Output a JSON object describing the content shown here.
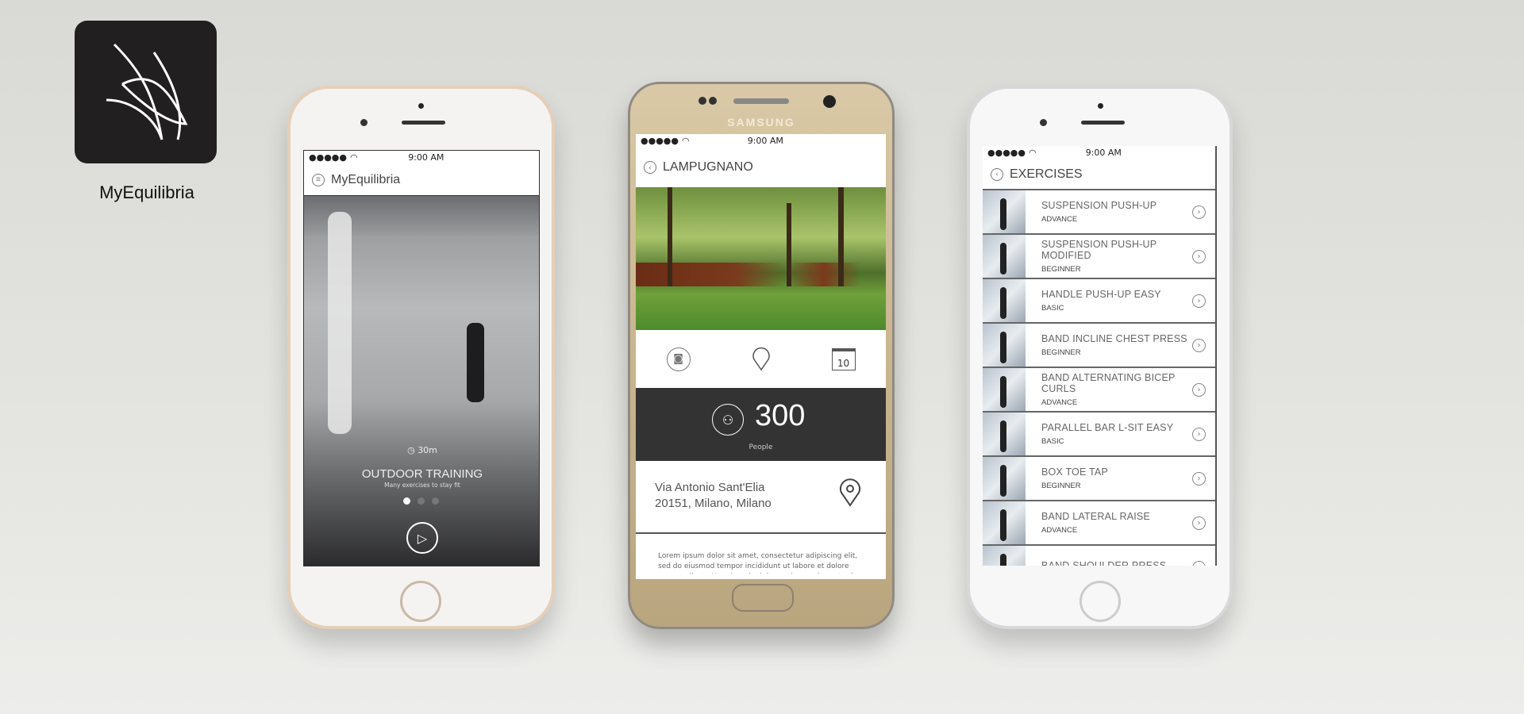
{
  "brand": {
    "name": "MyEquilibria"
  },
  "phone1": {
    "status": {
      "signal": "●●●●●",
      "time": "9:00 AM"
    },
    "header": {
      "title": "MyEquilibria",
      "icon": "menu-icon"
    },
    "hero": {
      "duration": "30m",
      "title": "OUTDOOR TRAINING",
      "subtitle": "Many exercises to stay fit",
      "slides": 3,
      "active_slide": 1
    }
  },
  "phone2": {
    "device_brand": "SAMSUNG",
    "status": {
      "signal": "●●●●●",
      "time": "9:00 AM"
    },
    "header": {
      "title": "LAMPUGNANO"
    },
    "icons": [
      "camera-icon",
      "location-pin-icon",
      "calendar-icon"
    ],
    "calendar_day": "10",
    "people": {
      "count": "300",
      "label": "People"
    },
    "address": {
      "line1": "Via Antonio Sant'Elia",
      "line2": "20151, Milano, Milano"
    },
    "description": "Lorem ipsum dolor sit amet, consectetur adipiscing elit, sed do eiusmod tempor incididunt ut labore et dolore magna aliqua. Ut enim ad minim veniam, quis nostrud"
  },
  "phone3": {
    "status": {
      "signal": "●●●●●",
      "time": "9:00 AM"
    },
    "header": {
      "title": "EXERCISES"
    },
    "exercises": [
      {
        "name": "SUSPENSION PUSH-UP",
        "level": "ADVANCE"
      },
      {
        "name": "SUSPENSION PUSH-UP MODIFIED",
        "level": "BEGINNER"
      },
      {
        "name": "HANDLE PUSH-UP EASY",
        "level": "BASIC"
      },
      {
        "name": "BAND INCLINE CHEST PRESS",
        "level": "BEGINNER"
      },
      {
        "name": "BAND ALTERNATING BICEP CURLS",
        "level": "ADVANCE"
      },
      {
        "name": "PARALLEL BAR L-SIT EASY",
        "level": "BASIC"
      },
      {
        "name": "BOX TOE TAP",
        "level": "BEGINNER"
      },
      {
        "name": "BAND LATERAL RAISE",
        "level": "ADVANCE"
      },
      {
        "name": "BAND SHOULDER PRESS",
        "level": ""
      }
    ]
  }
}
